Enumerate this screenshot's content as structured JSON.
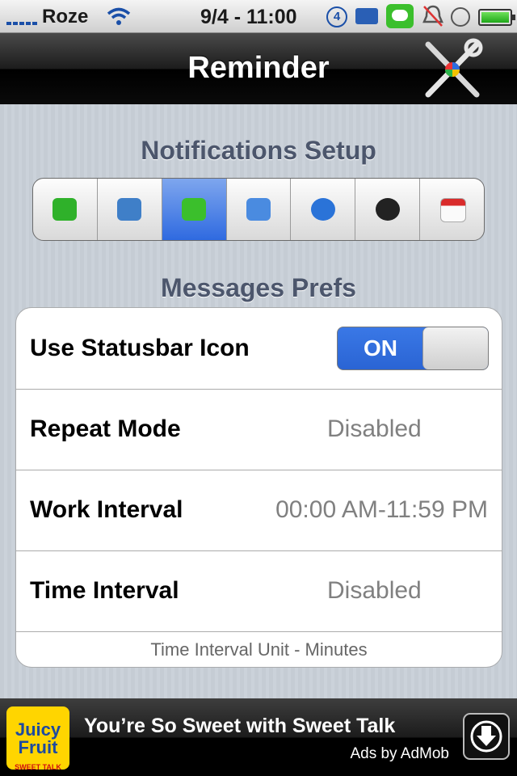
{
  "status_bar": {
    "carrier": "Roze",
    "time": "9/4 - 11:00",
    "notification_count": "4"
  },
  "nav": {
    "title": "Reminder",
    "settings_icon": "tools-icon"
  },
  "notifications_setup": {
    "header": "Notifications Setup",
    "segments": [
      {
        "name": "phone",
        "icon": "phone-icon",
        "color": "#2fb12a"
      },
      {
        "name": "voicemail",
        "icon": "voicemail-icon",
        "color": "#3f7fc8"
      },
      {
        "name": "messages",
        "icon": "messages-icon",
        "color": "#3bbf2c",
        "selected": true
      },
      {
        "name": "mail",
        "icon": "mail-icon",
        "color": "#4a8be0"
      },
      {
        "name": "messenger",
        "icon": "messenger-icon",
        "color": "#2a73d8"
      },
      {
        "name": "contacts",
        "icon": "contacts-icon",
        "color": "#222222"
      },
      {
        "name": "calendar",
        "icon": "calendar-icon",
        "color": "#d92b2b"
      }
    ]
  },
  "messages_prefs": {
    "header": "Messages Prefs",
    "rows": [
      {
        "label": "Use Statusbar Icon",
        "switch_label": "ON",
        "switch_on": true
      },
      {
        "label": "Repeat Mode",
        "value": "Disabled"
      },
      {
        "label": "Work Interval",
        "value": "00:00 AM-11:59 PM"
      },
      {
        "label": "Time Interval",
        "value": "Disabled"
      }
    ],
    "footer": "Time Interval Unit - Minutes"
  },
  "ad": {
    "logo_line1": "Juicy Fruit",
    "logo_line2": "SWEET TALK",
    "title": "You’re So Sweet with Sweet Talk",
    "by": "Ads by AdMob"
  },
  "colors": {
    "accent": "#2f6ae0",
    "section_header": "#4c566c"
  }
}
